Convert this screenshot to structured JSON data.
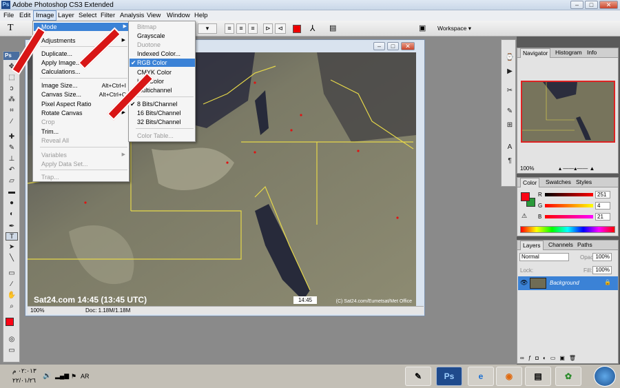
{
  "app": {
    "title": "Adobe Photoshop CS3 Extended"
  },
  "menubar": {
    "items": [
      "File",
      "Edit",
      "Image",
      "Layer",
      "Select",
      "Filter",
      "Analysis",
      "View",
      "Window",
      "Help"
    ]
  },
  "optionsbar": {
    "tool_glyph": "T",
    "workspace_label": "Workspace ▾"
  },
  "image_menu": {
    "items": [
      {
        "label": "Mode",
        "highlighted": true,
        "submenu": true
      },
      {
        "label": "Adjustments",
        "submenu": true
      },
      {
        "label": "Duplicate..."
      },
      {
        "label": "Apply Image..."
      },
      {
        "label": "Calculations..."
      },
      {
        "label": "Image Size...",
        "shortcut": "Alt+Ctrl+I"
      },
      {
        "label": "Canvas Size...",
        "shortcut": "Alt+Ctrl+C"
      },
      {
        "label": "Pixel Aspect Ratio",
        "submenu": true
      },
      {
        "label": "Rotate Canvas",
        "submenu": true
      },
      {
        "label": "Crop",
        "disabled": true
      },
      {
        "label": "Trim..."
      },
      {
        "label": "Reveal All",
        "disabled": true
      },
      {
        "label": "Variables",
        "disabled": true,
        "submenu": true
      },
      {
        "label": "Apply Data Set...",
        "disabled": true
      },
      {
        "label": "Trap...",
        "disabled": true
      }
    ]
  },
  "mode_menu": {
    "items": [
      {
        "label": "Bitmap",
        "disabled": true
      },
      {
        "label": "Grayscale"
      },
      {
        "label": "Duotone",
        "disabled": true
      },
      {
        "label": "Indexed Color..."
      },
      {
        "label": "RGB Color",
        "checked": true,
        "highlighted": true
      },
      {
        "label": "CMYK Color"
      },
      {
        "label": "Lab Color"
      },
      {
        "label": "Multichannel"
      },
      {
        "label": "8 Bits/Channel",
        "checked": true
      },
      {
        "label": "16 Bits/Channel"
      },
      {
        "label": "32 Bits/Channel"
      },
      {
        "label": "Color Table...",
        "disabled": true
      }
    ]
  },
  "document": {
    "caption": "Sat24.com 14:45 (13:45 UTC)",
    "timestamp": "14:45",
    "copyright": "(C) Sat24.com/Eumetsat/Met Office",
    "zoom": "100%",
    "doc_info": "Doc: 1.18M/1.18M"
  },
  "navigator": {
    "tabs": [
      "Navigator",
      "Histogram",
      "Info"
    ],
    "zoom": "100%"
  },
  "color_panel": {
    "tabs": [
      "Color",
      "Swatches",
      "Styles"
    ],
    "r_label": "R",
    "g_label": "G",
    "b_label": "B",
    "r": "251",
    "g": "4",
    "b": "21",
    "fg_color": "#fb0415",
    "bg_color": "#2a9a3a"
  },
  "layers_panel": {
    "tabs": [
      "Layers",
      "Channels",
      "Paths"
    ],
    "blend_mode": "Normal",
    "opacity_label": "Opacity:",
    "opacity": "100%",
    "lock_label": "Lock:",
    "fill_label": "Fill:",
    "fill": "100%",
    "layer_name": "Background"
  },
  "taskbar": {
    "time": "٠٢:٠١٣ م",
    "date": "٢٢/٠١/٢٦",
    "lang": "AR"
  }
}
